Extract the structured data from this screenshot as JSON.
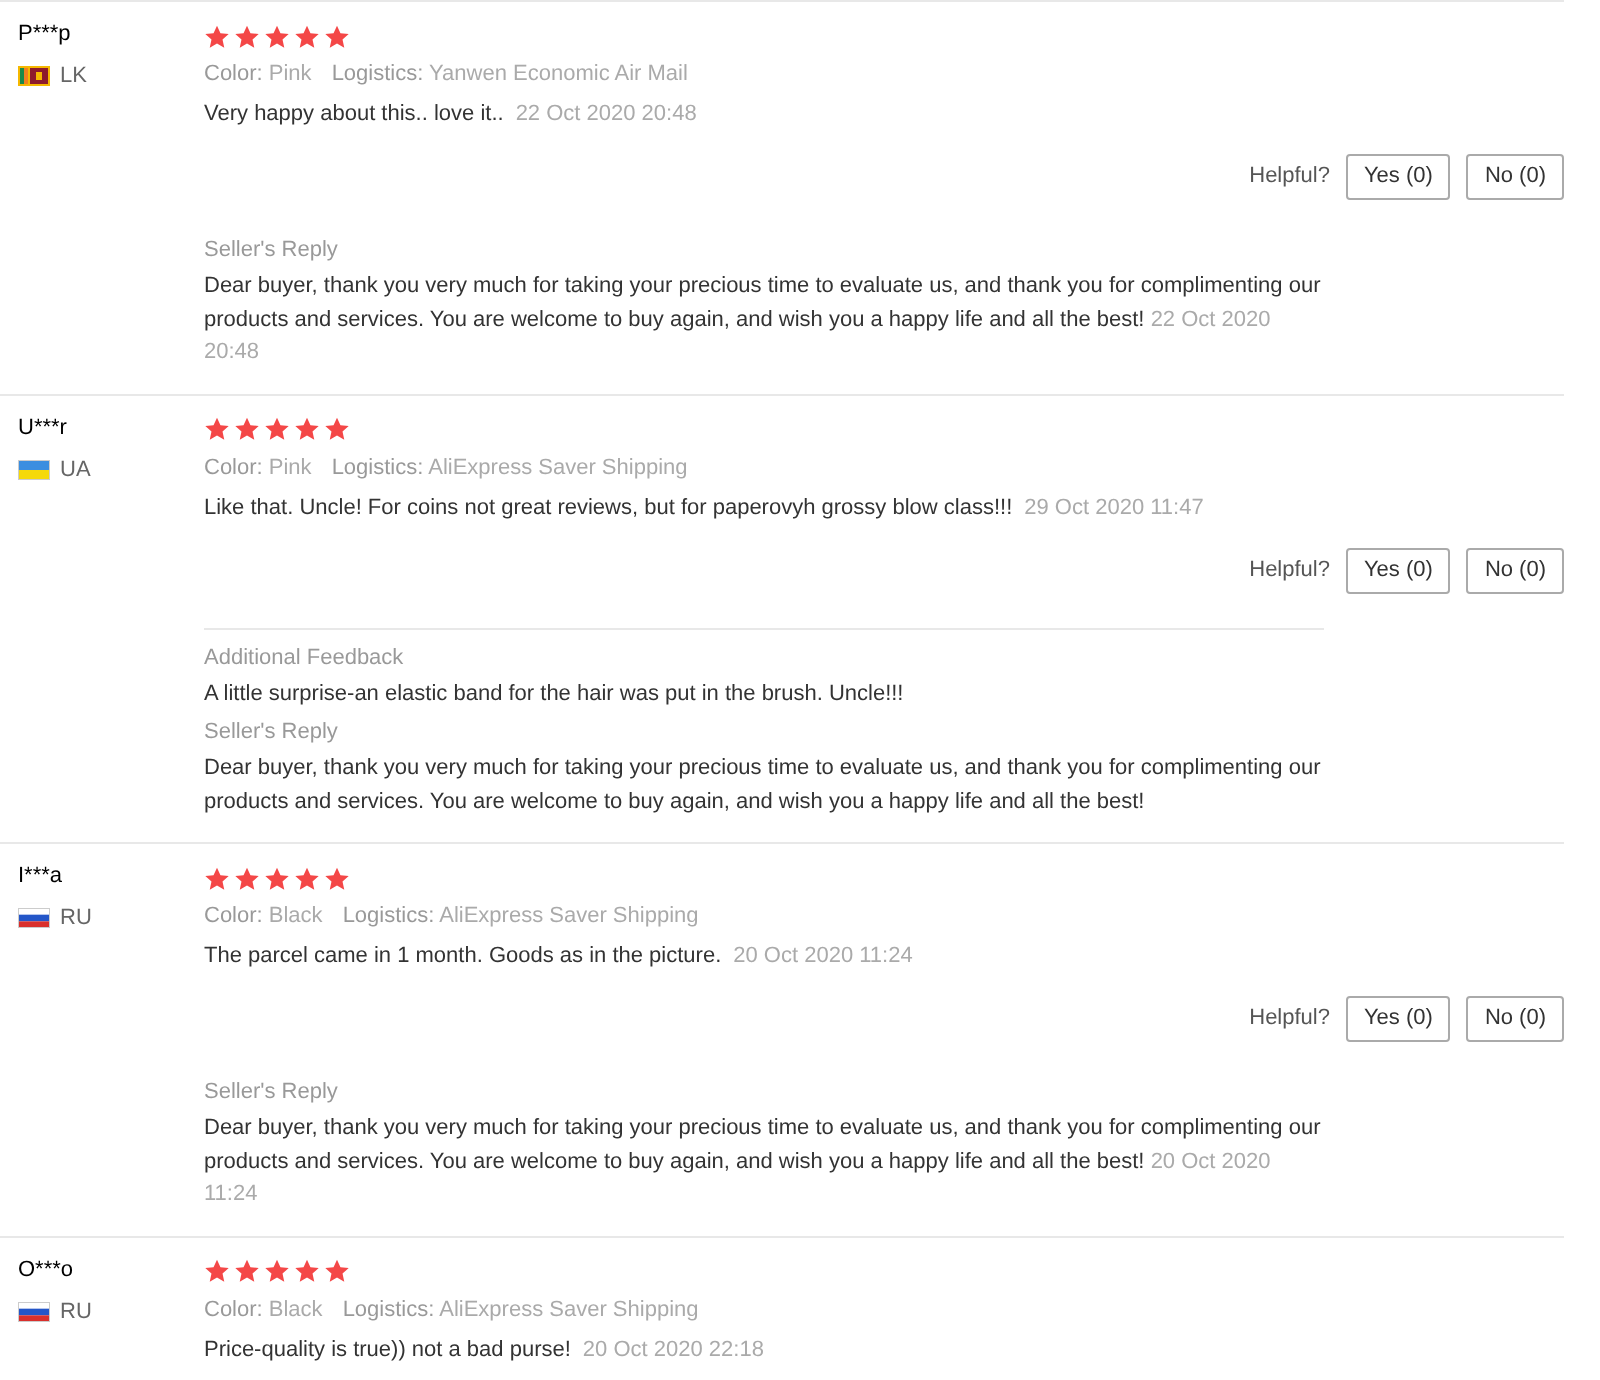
{
  "reviews": [
    {
      "name": "P***p",
      "kind": "sri-lanka",
      "country": "LK",
      "stars": 5,
      "color_label": "Color:",
      "color_value": "Pink",
      "logistics_label": "Logistics:",
      "logistics": "Yanwen Economic Air Mail",
      "text": "Very happy about this.. love it..",
      "date": "22 Oct 2020 20:48",
      "helpful_label": "Helpful?",
      "yes": "Yes (0)",
      "no": "No (0)",
      "replies": [
        {
          "kind": "seller",
          "heading": "Seller's Reply",
          "text": "Dear buyer, thank you very much for taking your precious time to evaluate us, and thank you for complimenting our products and services. You are welcome to buy again, and wish you a happy life and all the best!",
          "date": "22 Oct 2020 20:48"
        }
      ]
    },
    {
      "name": "U***r",
      "kind": "ukraine",
      "country": "UA",
      "stars": 5,
      "color_label": "Color:",
      "color_value": "Pink",
      "logistics_label": "Logistics:",
      "logistics": "AliExpress Saver Shipping",
      "text": "Like that. Uncle! For coins not great reviews, but for paperovyh grossy blow class!!!",
      "date": "29 Oct 2020 11:47",
      "helpful_label": "Helpful?",
      "yes": "Yes (0)",
      "no": "No (0)",
      "replies": [
        {
          "kind": "additional",
          "heading": "Additional Feedback",
          "text": "A little surprise-an elastic band for the hair was put in the brush. Uncle!!!"
        },
        {
          "kind": "seller",
          "heading": "Seller's Reply",
          "text": "Dear buyer, thank you very much for taking your precious time to evaluate us, and thank you for complimenting our products and services. You are welcome to buy again, and wish you a happy life and all the best!"
        }
      ]
    },
    {
      "name": "I***a",
      "kind": "russia",
      "country": "RU",
      "stars": 5,
      "color_label": "Color:",
      "color_value": "Black",
      "logistics_label": "Logistics:",
      "logistics": "AliExpress Saver Shipping",
      "text": "The parcel came in 1 month. Goods as in the picture.",
      "date": "20 Oct 2020 11:24",
      "helpful_label": "Helpful?",
      "yes": "Yes (0)",
      "no": "No (0)",
      "replies": [
        {
          "kind": "seller",
          "heading": "Seller's Reply",
          "text": "Dear buyer, thank you very much for taking your precious time to evaluate us, and thank you for complimenting our products and services. You are welcome to buy again, and wish you a happy life and all the best!",
          "date": "20 Oct 2020 11:24"
        }
      ]
    },
    {
      "name": "O***o",
      "kind": "russia",
      "country": "RU",
      "stars": 5,
      "color_label": "Color:",
      "color_value": "Black",
      "logistics_label": "Logistics:",
      "logistics": "AliExpress Saver Shipping",
      "text": "Price-quality is true)) not a bad purse!",
      "date": "20 Oct 2020 22:18"
    }
  ]
}
